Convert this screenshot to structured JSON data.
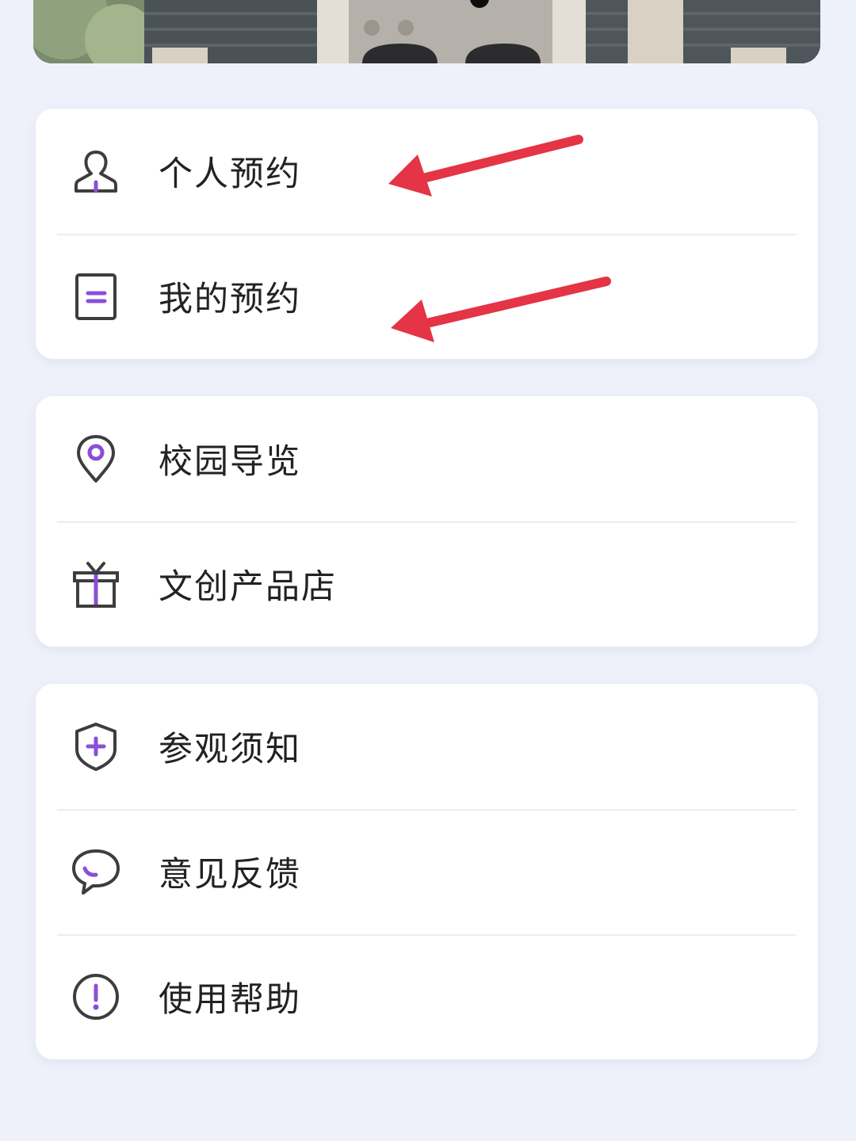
{
  "banner": {
    "carousel_dots": 1
  },
  "groups": [
    {
      "items": [
        {
          "label": "个人预约",
          "icon": "person-icon"
        },
        {
          "label": "我的预约",
          "icon": "document-icon"
        }
      ]
    },
    {
      "items": [
        {
          "label": "校园导览",
          "icon": "location-pin-icon"
        },
        {
          "label": "文创产品店",
          "icon": "gift-icon"
        }
      ]
    },
    {
      "items": [
        {
          "label": "参观须知",
          "icon": "shield-plus-icon"
        },
        {
          "label": "意见反馈",
          "icon": "chat-bubble-icon"
        },
        {
          "label": "使用帮助",
          "icon": "exclamation-circle-icon"
        }
      ]
    }
  ],
  "colors": {
    "accent": "#8a4fd6",
    "icon_stroke": "#3d3d3d",
    "annotation_arrow": "#e43445",
    "background": "#eef1fa"
  }
}
